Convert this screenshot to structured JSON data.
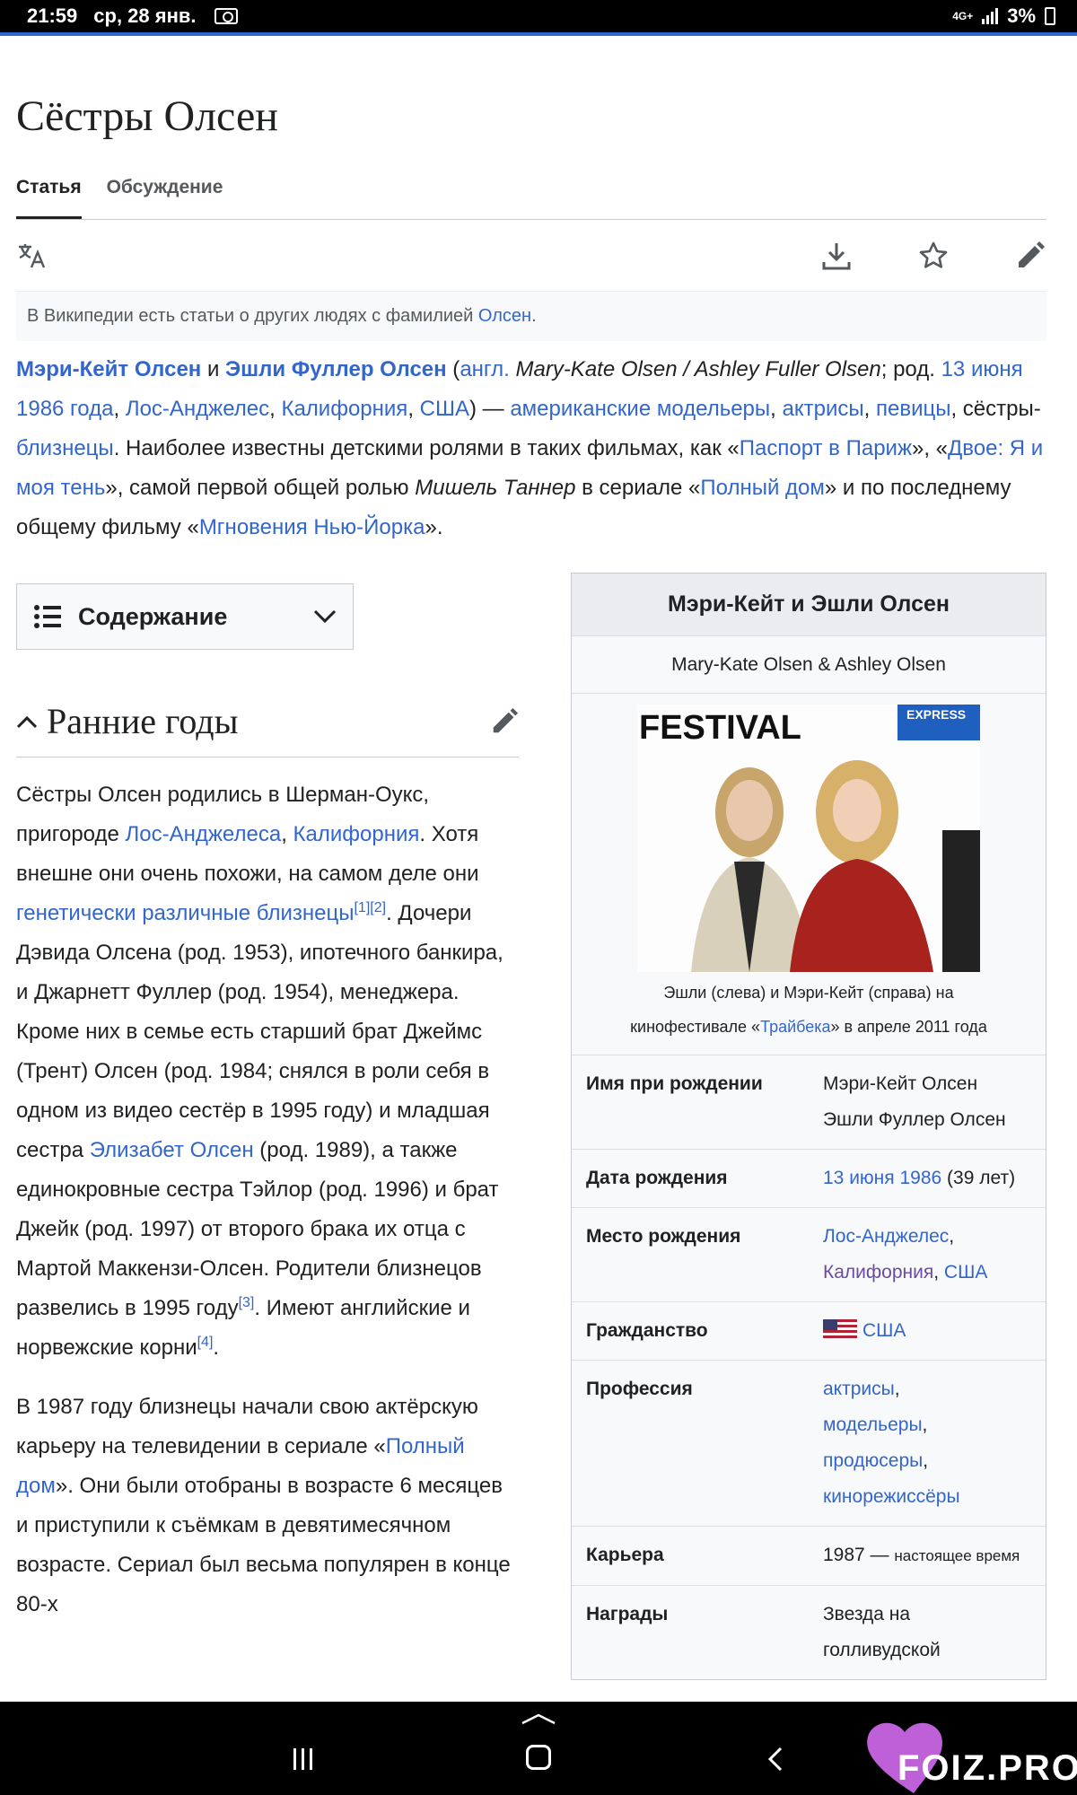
{
  "statusbar": {
    "time": "21:59",
    "date": "ср, 28 янв.",
    "network": "4G+",
    "battery": "3%"
  },
  "page": {
    "title": "Сёстры Олсен",
    "tabs": [
      {
        "label": "Статья",
        "active": true
      },
      {
        "label": "Обсуждение",
        "active": false
      }
    ],
    "hatnote": {
      "text": "В Википедии есть статьи о других людях с фамилией ",
      "link": "Олсен",
      "end": "."
    }
  },
  "lead": {
    "name1": "Мэри-Кейт Олсен",
    "and": " и ",
    "name2": "Эшли Фуллер Олсен",
    "p1": " (",
    "lang": "англ.",
    "orig": " Mary-Kate Olsen / Ashley Fuller Olsen",
    "p2": "; род. ",
    "date": "13 июня 1986 года",
    "c1": ", ",
    "city": "Лос-Анджелес",
    "c2": ", ",
    "state": "Калифорния",
    "c3": ", ",
    "country": "США",
    "p3": ") — ",
    "designers": "американские модельеры",
    "c4": ", ",
    "actresses": "актрисы",
    "c5": ", ",
    "singers": "певицы",
    "p4": ", сёстры-",
    "twins": "близнецы",
    "p5": ". Наиболее известны детскими ролями в таких фильмах, как «",
    "film1": "Паспорт в Париж",
    "p6": "», «",
    "film2": "Двое: Я и моя тень",
    "p7": "», самой первой общей ролью ",
    "role": "Мишель Таннер",
    "p8": " в сериале «",
    "series": "Полный дом",
    "p9": "» и по последнему общему фильму «",
    "film3": "Мгновения Нью-Йорка",
    "p10": "»."
  },
  "toc": {
    "label": "Содержание"
  },
  "section": {
    "title": "Ранние годы"
  },
  "para1": {
    "t1": "Сёстры Олсен родились в Шерман-Оукс, пригороде ",
    "l1": "Лос-Анджелеса",
    "t2": ", ",
    "l2": "Калифорния",
    "t3": ". Хотя внешне они очень похожи, на самом деле они ",
    "l3": "генетически различные близнецы",
    "r1": "[1]",
    "r2": "[2]",
    "t4": ". Дочери Дэвида Олсена (род. 1953), ипотечного банкира, и Джарнетт Фуллер (род. 1954), менеджера. Кроме них в семье есть старший брат Джеймс (Трент) Олсен (род. 1984; снялся в роли себя в одном из видео сестёр в 1995 году) и младшая сестра ",
    "l4": "Элизабет Олсен",
    "t5": " (род. 1989), а также единокровные сестра Тэйлор (род. 1996) и брат Джейк (род. 1997) от второго брака их отца с Мартой Маккензи-Олсен. Родители близнецов развелись в 1995 году",
    "r3": "[3]",
    "t6": ". Имеют английские и норвежские корни",
    "r4": "[4]",
    "t7": "."
  },
  "para2": {
    "t1": "В 1987 году близнецы начали свою актёрскую карьеру на телевидении в сериале «",
    "l1": "Полный дом",
    "t2": "». Они были отобраны в возрасте 6 месяцев и приступили к съёмкам в девятимесячном возрасте. Сериал был весьма популярен в конце 80-х"
  },
  "infobox": {
    "title": "Мэри-Кейт и Эшли Олсен",
    "subtitle": "Mary-Kate Olsen & Ashley Olsen",
    "image_sign": "FESTIVAL",
    "image_sign2": "EXPRESS",
    "caption1": "Эшли (слева) и Мэри-Кейт (справа) на",
    "caption2a": "кинофестивале «",
    "caption_link": "Трайбека",
    "caption2b": "» в апреле 2011 года",
    "rows": {
      "birthname": {
        "k": "Имя при рождении",
        "v1": "Мэри-Кейт Олсен",
        "v2": "Эшли Фуллер Олсен"
      },
      "birthdate": {
        "k": "Дата рождения",
        "link": "13 июня 1986",
        "tail": " (39 лет)"
      },
      "birthplace": {
        "k": "Место рождения",
        "l1": "Лос-Анджелес",
        "l2": "Калифорния",
        "l3": "США"
      },
      "citizenship": {
        "k": "Гражданство",
        "link": "США"
      },
      "profession": {
        "k": "Профессия",
        "l1": "актрисы",
        "l2": "модельеры",
        "l3": "продюсеры",
        "l4": "кинорежиссёры"
      },
      "career": {
        "k": "Карьера",
        "v": "1987 — ",
        "small": "настоящее время"
      },
      "awards": {
        "k": "Награды",
        "v": "Звезда на голливудской"
      }
    }
  },
  "watermark": "FOIZ.PRO",
  "colors": {
    "link": "#3366cc",
    "text": "#202122",
    "infobox_bg": "#f8f9fa",
    "header_bg": "#eaecf0"
  }
}
